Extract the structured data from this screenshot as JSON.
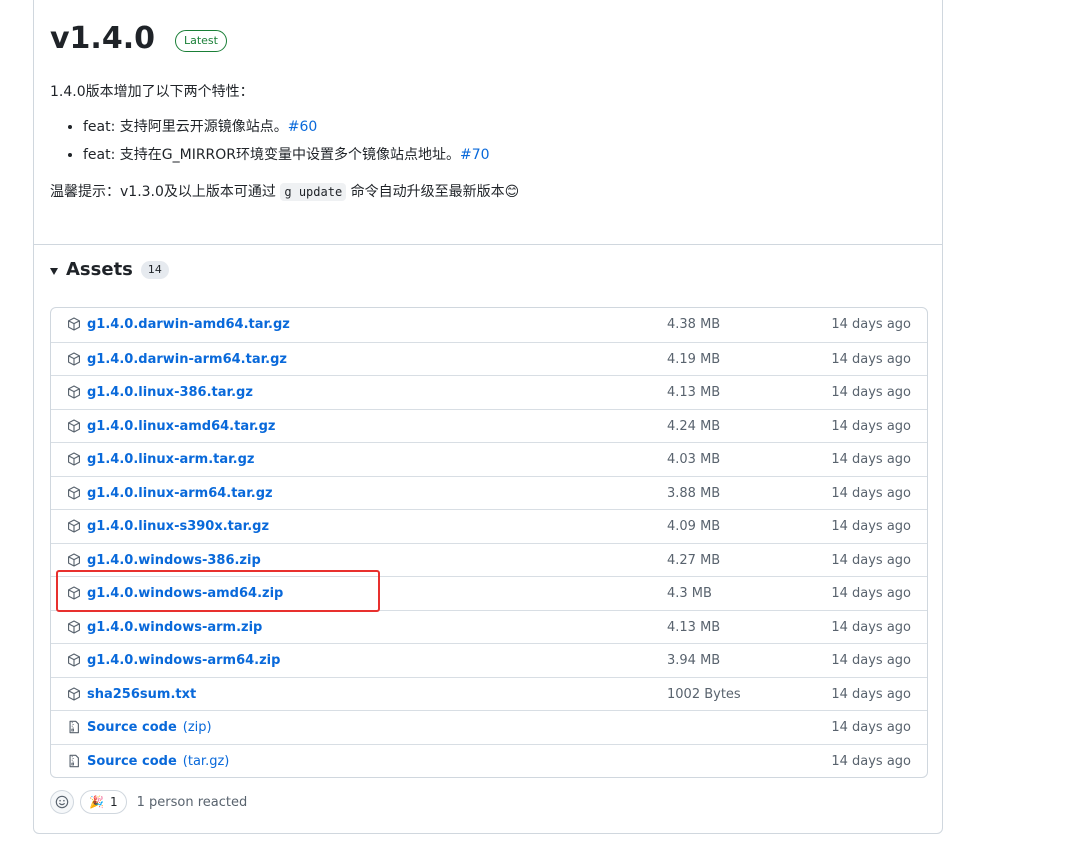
{
  "release": {
    "title": "v1.4.0",
    "badge": "Latest",
    "intro": "1.4.0版本增加了以下两个特性：",
    "features": [
      {
        "text": "feat: 支持阿里云开源镜像站点。",
        "issue": "#60"
      },
      {
        "text": "feat: 支持在G_MIRROR环境变量中设置多个镜像站点地址。",
        "issue": "#70"
      }
    ],
    "tip_before": "温馨提示：v1.3.0及以上版本可通过",
    "tip_code": "g update",
    "tip_after": "命令自动升级至最新版本",
    "tip_emoji": "😊"
  },
  "assets": {
    "title": "Assets",
    "count": "14",
    "items": [
      {
        "name": "g1.4.0.darwin-amd64.tar.gz",
        "size": "4.38 MB",
        "date": "14 days ago",
        "icon": "package-icon"
      },
      {
        "name": "g1.4.0.darwin-arm64.tar.gz",
        "size": "4.19 MB",
        "date": "14 days ago",
        "icon": "package-icon"
      },
      {
        "name": "g1.4.0.linux-386.tar.gz",
        "size": "4.13 MB",
        "date": "14 days ago",
        "icon": "package-icon"
      },
      {
        "name": "g1.4.0.linux-amd64.tar.gz",
        "size": "4.24 MB",
        "date": "14 days ago",
        "icon": "package-icon"
      },
      {
        "name": "g1.4.0.linux-arm.tar.gz",
        "size": "4.03 MB",
        "date": "14 days ago",
        "icon": "package-icon"
      },
      {
        "name": "g1.4.0.linux-arm64.tar.gz",
        "size": "3.88 MB",
        "date": "14 days ago",
        "icon": "package-icon"
      },
      {
        "name": "g1.4.0.linux-s390x.tar.gz",
        "size": "4.09 MB",
        "date": "14 days ago",
        "icon": "package-icon"
      },
      {
        "name": "g1.4.0.windows-386.zip",
        "size": "4.27 MB",
        "date": "14 days ago",
        "icon": "package-icon"
      },
      {
        "name": "g1.4.0.windows-amd64.zip",
        "size": "4.3 MB",
        "date": "14 days ago",
        "icon": "package-icon"
      },
      {
        "name": "g1.4.0.windows-arm.zip",
        "size": "4.13 MB",
        "date": "14 days ago",
        "icon": "package-icon"
      },
      {
        "name": "g1.4.0.windows-arm64.zip",
        "size": "3.94 MB",
        "date": "14 days ago",
        "icon": "package-icon"
      },
      {
        "name": "sha256sum.txt",
        "size": "1002 Bytes",
        "date": "14 days ago",
        "icon": "package-icon"
      },
      {
        "name": "Source code",
        "sub": "(zip)",
        "size": "",
        "date": "14 days ago",
        "icon": "file-zip-icon"
      },
      {
        "name": "Source code",
        "sub": "(tar.gz)",
        "size": "",
        "date": "14 days ago",
        "icon": "file-zip-icon"
      }
    ]
  },
  "reactions": {
    "emoji": "🎉",
    "count": "1",
    "summary": "1 person reacted"
  },
  "colors": {
    "link": "#0969da",
    "latest": "#1a7f37",
    "highlight": "#e8302e"
  }
}
